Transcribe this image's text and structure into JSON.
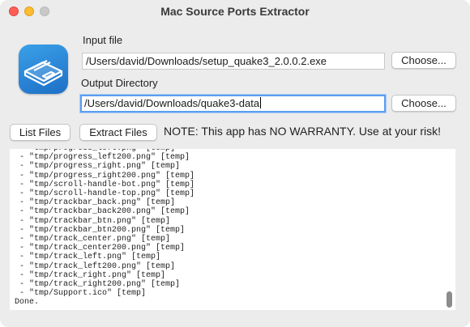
{
  "window": {
    "title": "Mac Source Ports Extractor",
    "controls": {
      "close_color": "#ff5f57",
      "minimize_color": "#febc2e",
      "maximize_color": "#c8c8c8"
    }
  },
  "app_icon": {
    "name": "disk-icon",
    "color": "#2a86d8"
  },
  "input": {
    "label": "Input file",
    "value": "/Users/david/Downloads/setup_quake3_2.0.0.2.exe",
    "choose_label": "Choose..."
  },
  "output": {
    "label": "Output Directory",
    "value": "/Users/david/Downloads/quake3-data",
    "choose_label": "Choose...",
    "focused": true
  },
  "actions": {
    "list_label": "List Files",
    "extract_label": "Extract Files",
    "note": "NOTE: This app has NO WARRANTY. Use at your risk!"
  },
  "log": {
    "lines": [
      " - \"tmp/progress_left.png\" [temp]",
      " - \"tmp/progress_left200.png\" [temp]",
      " - \"tmp/progress_right.png\" [temp]",
      " - \"tmp/progress_right200.png\" [temp]",
      " - \"tmp/scroll-handle-bot.png\" [temp]",
      " - \"tmp/scroll-handle-top.png\" [temp]",
      " - \"tmp/trackbar_back.png\" [temp]",
      " - \"tmp/trackbar_back200.png\" [temp]",
      " - \"tmp/trackbar_btn.png\" [temp]",
      " - \"tmp/trackbar_btn200.png\" [temp]",
      " - \"tmp/track_center.png\" [temp]",
      " - \"tmp/track_center200.png\" [temp]",
      " - \"tmp/track_left.png\" [temp]",
      " - \"tmp/track_left200.png\" [temp]",
      " - \"tmp/track_right.png\" [temp]",
      " - \"tmp/track_right200.png\" [temp]",
      " - \"tmp/Support.ico\" [temp]",
      "Done."
    ]
  }
}
